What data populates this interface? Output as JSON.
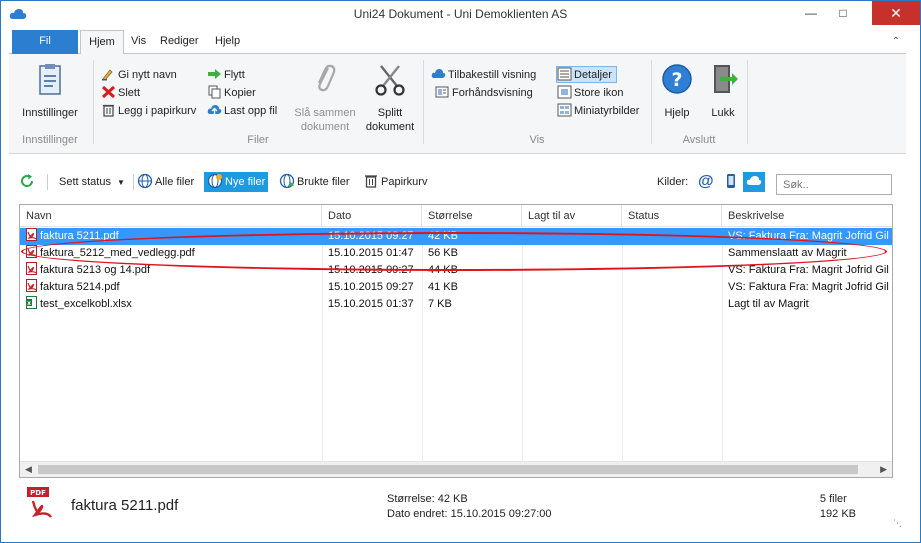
{
  "window": {
    "title": "Uni24 Dokument - Uni Demoklienten AS"
  },
  "tabs": {
    "file": "Fil",
    "hjem": "Hjem",
    "vis": "Vis",
    "rediger": "Rediger",
    "hjelp": "Hjelp"
  },
  "ribbon": {
    "innstillinger": {
      "button": "Innstillinger",
      "group": "Innstillinger"
    },
    "filer": {
      "group": "Filer",
      "rename": "Gi nytt navn",
      "delete": "Slett",
      "to_recycle": "Legg i papirkurv",
      "move": "Flytt",
      "copy": "Kopier",
      "upload": "Last opp fil",
      "merge_line1": "Slå sammen",
      "merge_line2": "dokument",
      "split_line1": "Splitt",
      "split_line2": "dokument"
    },
    "vis": {
      "group": "Vis",
      "reset_view": "Tilbakestill visning",
      "preview": "Forhåndsvisning",
      "details": "Detaljer",
      "large_icons": "Store ikon",
      "thumbnails": "Miniatyrbilder"
    },
    "avslutt": {
      "group": "Avslutt",
      "help": "Hjelp",
      "close": "Lukk"
    }
  },
  "toolbar": {
    "set_status": "Sett status",
    "all_files": "Alle filer",
    "new_files": "Nye filer",
    "used_files": "Brukte filer",
    "recycle_bin": "Papirkurv",
    "sources_label": "Kilder:",
    "search_placeholder": "Søk.."
  },
  "list": {
    "columns": [
      "Navn",
      "Dato",
      "Størrelse",
      "Lagt til av",
      "Status",
      "Beskrivelse"
    ],
    "rows": [
      {
        "name": "faktura 5211.pdf",
        "date": "15.10.2015 09:27",
        "size": "42 KB",
        "added_by": "",
        "status": "",
        "description": "VS: Faktura Fra: Magrit Jofrid Gil",
        "type": "pdf",
        "selected": true
      },
      {
        "name": "faktura_5212_med_vedlegg.pdf",
        "date": "15.10.2015 01:47",
        "size": "56 KB",
        "added_by": "",
        "status": "",
        "description": "Sammenslaatt av Magrit",
        "type": "pdf",
        "selected": false
      },
      {
        "name": "faktura 5213 og 14.pdf",
        "date": "15.10.2015 09:27",
        "size": "44 KB",
        "added_by": "",
        "status": "",
        "description": "VS: Faktura Fra: Magrit Jofrid Gil",
        "type": "pdf",
        "selected": false
      },
      {
        "name": "faktura 5214.pdf",
        "date": "15.10.2015 09:27",
        "size": "41 KB",
        "added_by": "",
        "status": "",
        "description": "VS: Faktura Fra: Magrit Jofrid Gil",
        "type": "pdf",
        "selected": false
      },
      {
        "name": "test_excelkobl.xlsx",
        "date": "15.10.2015 01:37",
        "size": "7 KB",
        "added_by": "",
        "status": "",
        "description": "Lagt til av Magrit",
        "type": "xlsx",
        "selected": false
      }
    ]
  },
  "footer": {
    "file_name": "faktura 5211.pdf",
    "size_text": "Størrelse: 42 KB",
    "modified_text": "Dato endret: 15.10.2015 09:27:00",
    "count_text": "5 filer",
    "total_size": "192 KB"
  },
  "colors": {
    "accent": "#2b7ed0",
    "selection": "#3399ff",
    "highlight_ring": "#e0141e",
    "active_filter": "#1d9ae0"
  }
}
